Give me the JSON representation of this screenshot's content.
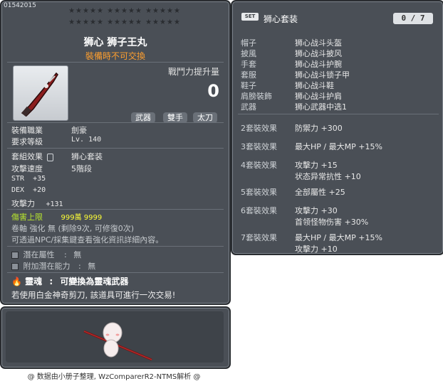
{
  "item": {
    "code": "01542015",
    "stars_row1": "★★★★★  ★★★★★  ★★★★★",
    "stars_row2": "★★★★★  ★★★★★  ★★★★★",
    "title": "狮心 狮子王丸",
    "subtitle": "裝備時不可交換",
    "power_label": "戰鬥力提升量",
    "power_value": "0",
    "badges": [
      "武器",
      "雙手",
      "太刀"
    ],
    "req_job_label": "裝備職業",
    "req_job_value": "劍豪",
    "req_level_label": "要求等級",
    "req_level_value": "Lv. 140",
    "set_label": "套組效果",
    "set_value": "狮心套装",
    "speed_label": "攻擊速度",
    "speed_value": "5階段",
    "str_label": "STR",
    "str_value": "+35",
    "dex_label": "DEX",
    "dex_value": "+20",
    "atk_label": "攻擊力",
    "atk_value": "+131",
    "dmg_cap_label": "傷害上限",
    "dmg_cap_value": "999萬 9999",
    "scroll_line": "卷軸 強化 無 (剩除9次, 可修復0次)",
    "npc_line": "可透過NPC/採集鍵查看強化資訊詳細內容。",
    "potential_label": "潛在屬性",
    "potential_value": "無",
    "bonus_potential_label": "附加潛在能力",
    "bonus_potential_value": "無",
    "soul_label": "靈魂",
    "soul_value": "可變換為靈魂武器",
    "trade_note": "若使用白金神奇剪刀, 該道具可進行一次交易!"
  },
  "set": {
    "badge": "SET",
    "title": "狮心套装",
    "count": "0 / 7",
    "parts": [
      {
        "slot": "帽子",
        "name": "狮心战斗头盔"
      },
      {
        "slot": "披風",
        "name": "狮心战斗披风"
      },
      {
        "slot": "手套",
        "name": "狮心战斗护腕"
      },
      {
        "slot": "套服",
        "name": "狮心战斗锁子甲"
      },
      {
        "slot": "鞋子",
        "name": "狮心战斗鞋"
      },
      {
        "slot": "肩膀裝飾",
        "name": "狮心战斗护肩"
      },
      {
        "slot": "武器",
        "name": "狮心武器中选1"
      }
    ],
    "effects": [
      {
        "label": "2套裝效果",
        "lines": [
          "防禦力  +300"
        ]
      },
      {
        "label": "3套裝效果",
        "lines": [
          "最大HP / 最大MP  +15%"
        ]
      },
      {
        "label": "4套裝效果",
        "lines": [
          "攻擊力  +15",
          "状态异常抗性  +10"
        ]
      },
      {
        "label": "5套裝效果",
        "lines": [
          "全部屬性  +25"
        ]
      },
      {
        "label": "6套裝效果",
        "lines": [
          "攻擊力  +30",
          "首领怪物伤害  +30%"
        ]
      },
      {
        "label": "7套裝效果",
        "lines": [
          "最大HP / 最大MP  +15%",
          "攻擊力  +10"
        ]
      }
    ]
  },
  "footer": "@ 数据由小册子整理, WzComparerR2-NTMS解析 @"
}
